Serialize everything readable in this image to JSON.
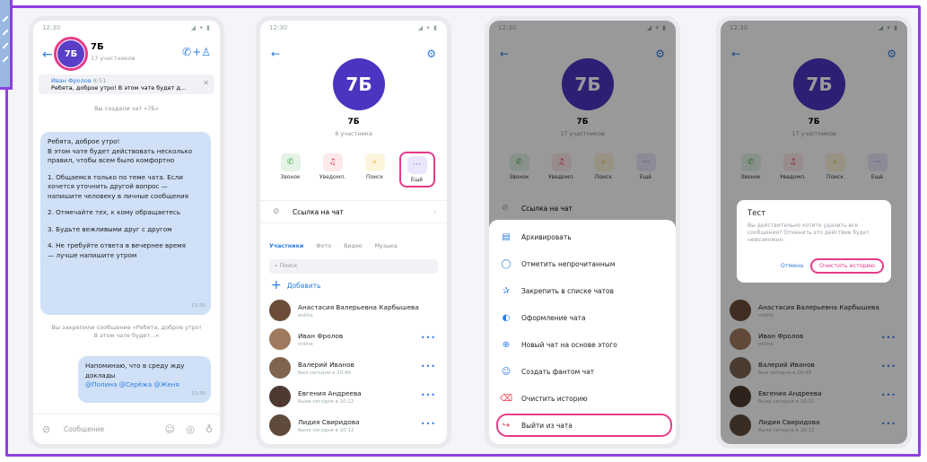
{
  "phone1": {
    "time": "12:30",
    "status_icons": "◢ ▾ ▮",
    "avatar": "7Б",
    "title": "7Б",
    "subtitle": "17 участников",
    "pinned_author": "Иван Фролов",
    "pinned_time": "8:51",
    "pinned_text": "Ребята, доброе утро! В этом чате будет д...",
    "created": "Вы создали чат «7Б»",
    "message1": [
      "Ребята, доброе утро!\nВ этом чате будет действовать несколько правил, чтобы всем было комфортно",
      "1. Общаемся только по теме чата. Если хочется уточнить другой вопрос — напишите человеку в личные сообщения",
      "2. Отмечайте тех, к кому обращаетесь",
      "3. Будьте вежливыми друг с другом",
      "4. Не требуйте ответа в вечернее время — лучше напишите утром"
    ],
    "message1_time": "12:30",
    "pinned_notice": "Вы закрепили сообщение «Ребята, доброе утро! В этом чате будет...»",
    "message2_text": "Напоминаю, что в среду жду доклады",
    "message2_mentions": "@Полина @Серёжа @Женя",
    "message2_time": "12:30",
    "composer_placeholder": "Сообщение"
  },
  "profile": {
    "avatar": "7Б",
    "title": "7Б",
    "subtitle_p2": "8 участника",
    "subtitle": "17 участников",
    "actions": [
      "Звонок",
      "Уведомл.",
      "Поиск",
      "Ещё"
    ],
    "link_row": "Ссылка на чат",
    "tabs": [
      "Участники",
      "Фото",
      "Видео",
      "Музыка"
    ],
    "search_placeholder": "Поиск",
    "add_label": "Добавить",
    "members": [
      {
        "name": "Анастасия Валерьевна Карбышева",
        "status": "online"
      },
      {
        "name": "Иван Фролов",
        "status": "online"
      },
      {
        "name": "Валерий Иванов",
        "status": "был сегодня в 10:49"
      },
      {
        "name": "Евгения Андреева",
        "status": "была сегодня в 10:12"
      },
      {
        "name": "Лидия Свиридова",
        "status": "была сегодня в 10:12"
      }
    ]
  },
  "sheet": {
    "items": [
      "Архивировать",
      "Отметить непрочитанным",
      "Закрепить в списке чатов",
      "Оформление чата",
      "Новый чат на основе этого",
      "Создать фантом чат",
      "Очистить историю",
      "Выйти из чата"
    ]
  },
  "dialog": {
    "title": "Тест",
    "text": "Вы действительно хотите удалить все сообщения? Отменить это действие будет невозможно.",
    "cancel": "Отмена",
    "confirm": "Очистить историю"
  },
  "colors": {
    "accent": "#8e3fe0",
    "highlight": "#e63a8a",
    "link": "#2b7de0"
  }
}
